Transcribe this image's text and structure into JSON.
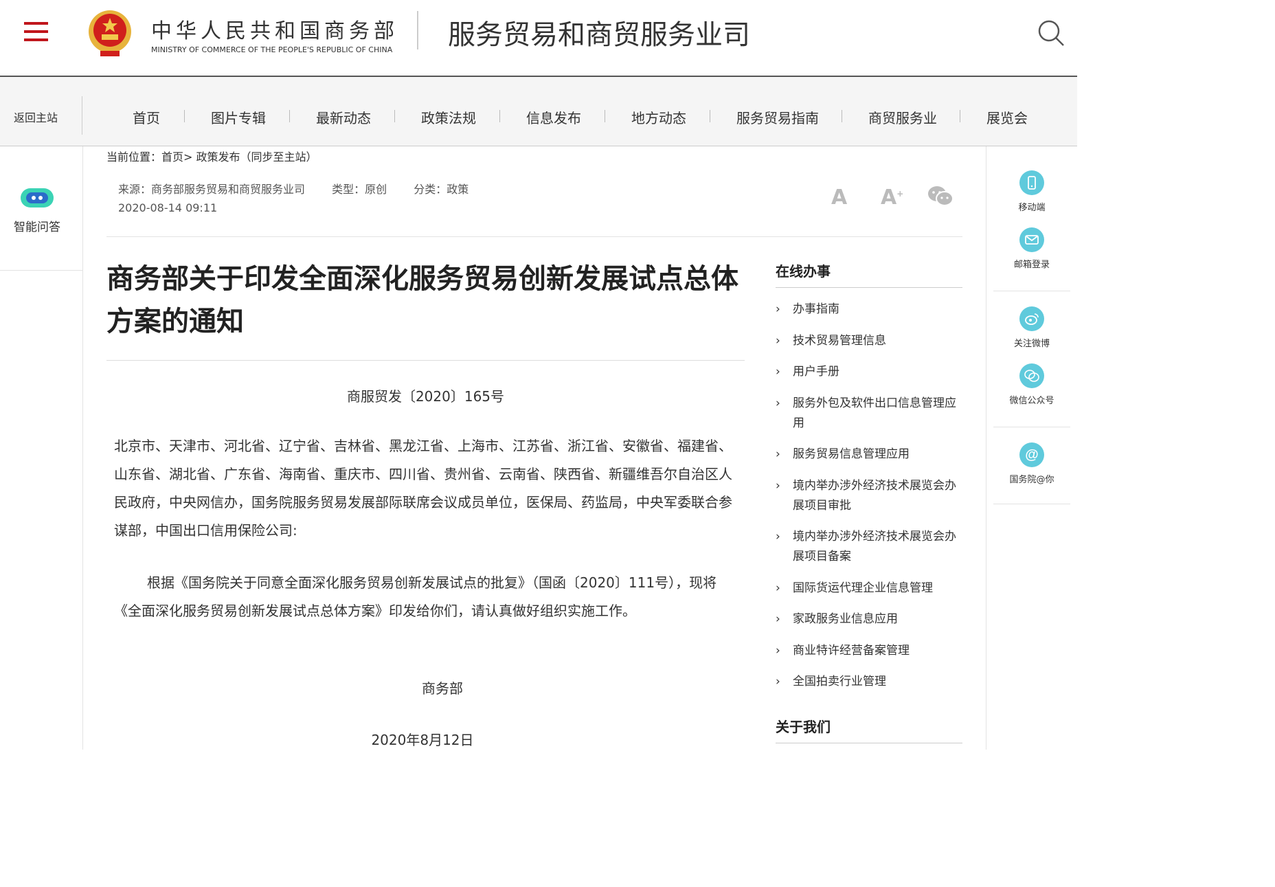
{
  "header": {
    "logo_cn": "中华人民共和国商务部",
    "logo_en": "MINISTRY OF COMMERCE OF THE PEOPLE'S REPUBLIC OF CHINA",
    "dept_title": "服务贸易和商贸服务业司",
    "menu_icon": "hamburger-icon",
    "search_icon": "search-icon",
    "accent_color": "#c0161c"
  },
  "nav": {
    "back_home": "返回主站",
    "items": [
      "首页",
      "图片专辑",
      "最新动态",
      "政策法规",
      "信息发布",
      "地方动态",
      "服务贸易指南",
      "商贸服务业",
      "展览会"
    ]
  },
  "left_sidebar": {
    "assistant_label": "智能问答",
    "assistant_icon": "robot-icon"
  },
  "breadcrumb": "当前位置：首页> 政策发布（同步至主站）",
  "meta": {
    "source": "来源：商务部服务贸易和商贸服务业司",
    "type": "类型：原创",
    "category": "分类：政策",
    "date": "2020-08-14 09:11",
    "font_decrease": "A",
    "font_increase": "A",
    "font_increase_sup": "+"
  },
  "article": {
    "title": "商务部关于印发全面深化服务贸易创新发展试点总体方案的通知",
    "doc_no": "商服贸发〔2020〕165号",
    "recipients": "北京市、天津市、河北省、辽宁省、吉林省、黑龙江省、上海市、江苏省、浙江省、安徽省、福建省、山东省、湖北省、广东省、海南省、重庆市、四川省、贵州省、云南省、陕西省、新疆维吾尔自治区人民政府，中央网信办，国务院服务贸易发展部际联席会议成员单位，医保局、药监局，中央军委联合参谋部，中国出口信用保险公司:",
    "body": "根据《国务院关于同意全面深化服务贸易创新发展试点的批复》（国函〔2020〕111号），现将《全面深化服务贸易创新发展试点总体方案》印发给你们，请认真做好组织实施工作。",
    "signer": "商务部",
    "sign_date": "2020年8月12日"
  },
  "online_service": {
    "title": "在线办事",
    "items": [
      "办事指南",
      "技术贸易管理信息",
      "用户手册",
      "服务外包及软件出口信息管理应用",
      "服务贸易信息管理应用",
      "境内举办涉外经济技术展览会办展项目审批",
      "境内举办涉外经济技术展览会办展项目备案",
      "国际货运代理企业信息管理",
      "家政服务业信息应用",
      "商业特许经营备案管理",
      "全国拍卖行业管理"
    ]
  },
  "about": {
    "title": "关于我们"
  },
  "right_sidebar": {
    "items": [
      {
        "label": "移动端",
        "icon": "mobile-icon"
      },
      {
        "label": "邮箱登录",
        "icon": "mail-icon"
      },
      {
        "label": "关注微博",
        "icon": "weibo-icon"
      },
      {
        "label": "微信公众号",
        "icon": "wechat-icon"
      },
      {
        "label": "国务院@你",
        "icon": "at-icon"
      }
    ]
  }
}
